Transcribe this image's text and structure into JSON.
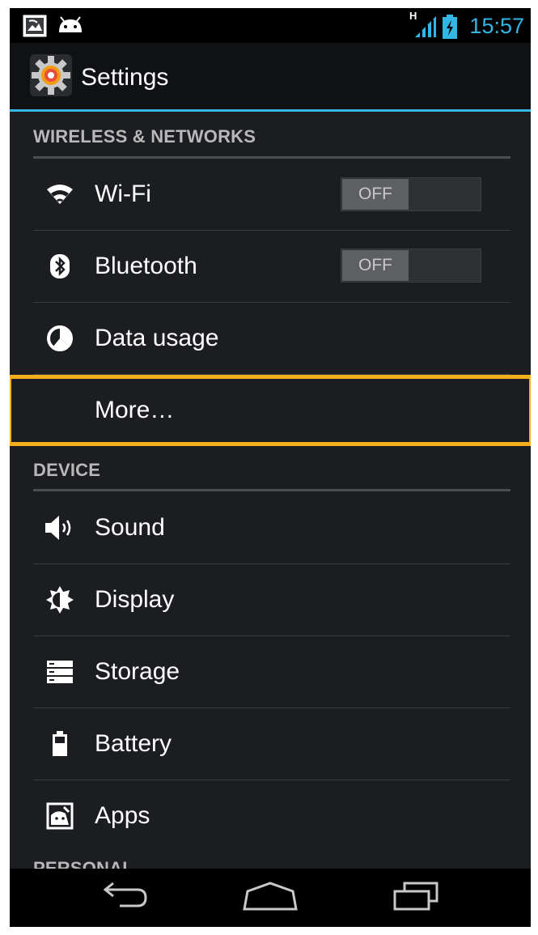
{
  "status_bar": {
    "clock": "15:57",
    "network_type": "H",
    "left_icons": [
      "gallery-notification-icon",
      "android-notification-icon"
    ],
    "right_icons": [
      "signal-icon",
      "battery-charging-icon"
    ],
    "accent_color": "#33b5e5"
  },
  "action_bar": {
    "title": "Settings",
    "icon": "settings-gear-icon"
  },
  "sections": [
    {
      "header": "WIRELESS & NETWORKS",
      "items": [
        {
          "label": "Wi-Fi",
          "icon": "wifi-icon",
          "toggle": "OFF"
        },
        {
          "label": "Bluetooth",
          "icon": "bluetooth-icon",
          "toggle": "OFF"
        },
        {
          "label": "Data usage",
          "icon": "data-usage-icon"
        },
        {
          "label": "More…",
          "icon": ""
        }
      ]
    },
    {
      "header": "DEVICE",
      "items": [
        {
          "label": "Sound",
          "icon": "sound-icon"
        },
        {
          "label": "Display",
          "icon": "display-icon"
        },
        {
          "label": "Storage",
          "icon": "storage-icon"
        },
        {
          "label": "Battery",
          "icon": "battery-icon"
        },
        {
          "label": "Apps",
          "icon": "apps-icon"
        }
      ]
    },
    {
      "header": "PERSONAL"
    }
  ],
  "highlight": {
    "color": "#f2b01e",
    "target": "More…"
  },
  "nav_bar": {
    "buttons": [
      "back-icon",
      "home-icon",
      "recent-apps-icon"
    ]
  }
}
